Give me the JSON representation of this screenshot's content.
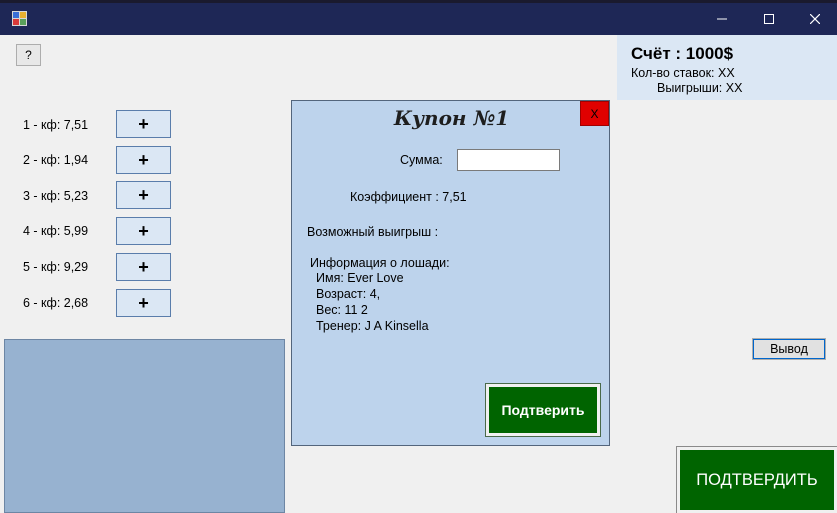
{
  "window": {
    "minimize_icon": "minimize-icon",
    "maximize_icon": "maximize-icon",
    "close_icon": "close-icon"
  },
  "help": {
    "label": "?"
  },
  "score": {
    "title": "Счёт : 1000$",
    "bets": "Кол-во ставок: XX",
    "wins": "Выигрыши: XX"
  },
  "horses": [
    {
      "label": "1 - кф: 7,51",
      "button": "+"
    },
    {
      "label": "2 - кф: 1,94",
      "button": "+"
    },
    {
      "label": "3 - кф: 5,23",
      "button": "+"
    },
    {
      "label": "4 - кф: 5,99",
      "button": "+"
    },
    {
      "label": "5 - кф: 9,29",
      "button": "+"
    },
    {
      "label": "6 - кф: 2,68",
      "button": "+"
    }
  ],
  "coupon": {
    "title": "Купон №1",
    "close_label": "X",
    "sum_label": "Сумма:",
    "sum_value": "",
    "coefficient": "Коэффициент : 7,51",
    "possible_win": "Возможный выигрыш :",
    "info_title": "Информация о лошади:",
    "info_lines": [
      "Имя: Ever Love",
      "Возраст: 4,",
      "Вес: 11 2",
      "Тренер: J A Kinsella"
    ],
    "confirm_label": "Подтверить"
  },
  "output_button": "Вывод",
  "confirm_big": "ПОДТВЕРДИТЬ",
  "colors": {
    "titlebar": "#1e2756",
    "panel_blue": "#bdd3ec",
    "confirm_green": "#006400",
    "close_red": "#e00000"
  }
}
